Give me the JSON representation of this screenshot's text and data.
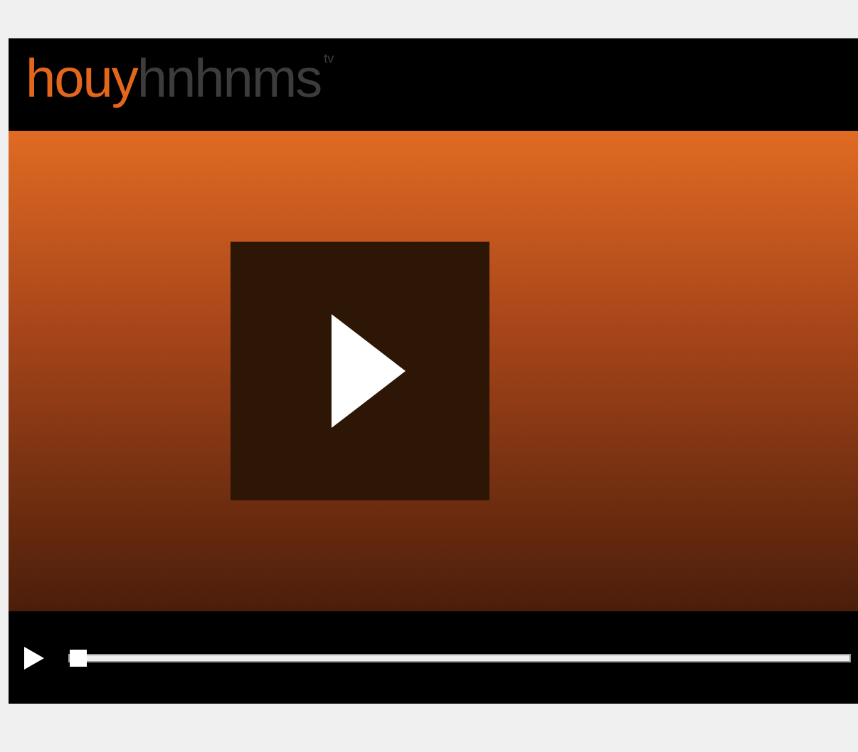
{
  "logo": {
    "accent": "houy",
    "rest": "hnhnms",
    "mark": "tv"
  },
  "controls": {
    "playing": false,
    "seek": {
      "level": 0
    }
  }
}
